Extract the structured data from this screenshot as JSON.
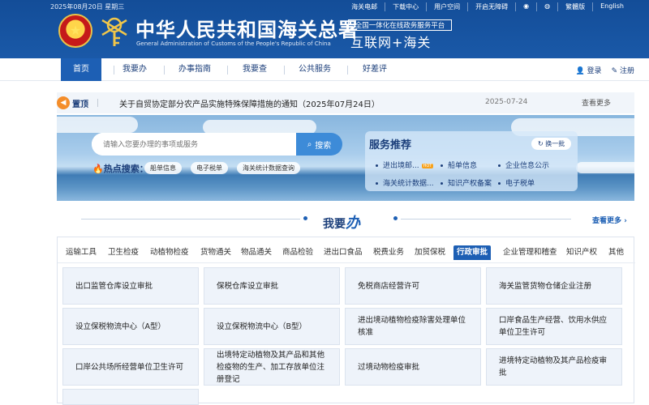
{
  "header": {
    "date": "2025年08月20日 星期三",
    "top_links": [
      "海关电邮",
      "下载中心",
      "用户空间",
      "开启无障碍",
      "繁體版",
      "English"
    ],
    "title": "中华人民共和国海关总署",
    "subtitle": "General Administration of Customs of the People's Republic of China",
    "platform_label": "全国一体化在线政务服务平台",
    "platform_slogan": "互联网+海关"
  },
  "nav": {
    "items": [
      "首页",
      "我要办",
      "办事指南",
      "我要查",
      "公共服务",
      "好差评"
    ],
    "active_index": 0,
    "login": "登录",
    "register": "注册"
  },
  "notice": {
    "tag": "置顶",
    "text": "关于自贸协定部分农产品实施特殊保障措施的通知（2025年07月24日）",
    "date": "2025-07-24",
    "more": "查看更多"
  },
  "search": {
    "placeholder": "请输入您要办理的事项或服务",
    "button": "搜索",
    "hot_label": "热点搜索：",
    "hot_tags": [
      "船单信息",
      "电子税单",
      "海关统计数据查询"
    ]
  },
  "service": {
    "title": "服务推荐",
    "switch": "换一批",
    "hot_badge": "HOT",
    "items": [
      "进出境邮...",
      "船单信息",
      "企业信息公示",
      "海关统计数据...",
      "知识产权备案",
      "电子税单"
    ]
  },
  "todo": {
    "title_prefix": "我要",
    "title_emph": "办",
    "more": "查看更多"
  },
  "categories": {
    "tabs": [
      "运输工具",
      "卫生检疫",
      "动植物检疫",
      "货物通关",
      "物品通关",
      "商品检验",
      "进出口食品",
      "税费业务",
      "加贸保税",
      "行政审批",
      "企业管理和稽查",
      "知识产权",
      "其他"
    ],
    "active_index": 9
  },
  "cards": [
    "出口监管仓库设立审批",
    "保税仓库设立审批",
    "免税商店经营许可",
    "海关监管货物仓储企业注册",
    "设立保税物流中心（A型）",
    "设立保税物流中心（B型）",
    "进出境动植物检疫除害处理单位核准",
    "口岸食品生产经营、饮用水供应单位卫生许可",
    "口岸公共场所经营单位卫生许可",
    "出境特定动植物及其产品和其他检疫物的生产、加工存放单位注册登记",
    "过境动物检疫审批",
    "进境特定动植物及其产品检疫审批"
  ],
  "colors": {
    "header_blue": "#134d98",
    "accent_blue": "#1d5fb4",
    "notice_orange": "#f48d2a",
    "hot_badge": "#f7a21b"
  }
}
